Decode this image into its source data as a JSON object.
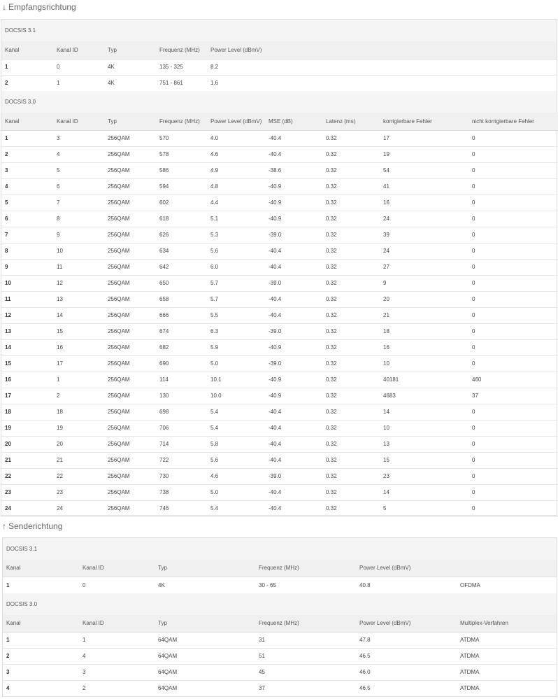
{
  "downstream": {
    "title_arrow": "↓",
    "title": "Empfangsrichtung",
    "docsis31": {
      "label": "DOCSIS 3.1",
      "headers": [
        "Kanal",
        "Kanal ID",
        "Typ",
        "Frequenz (MHz)",
        "Power Level (dBmV)"
      ],
      "rows": [
        [
          "1",
          "0",
          "4K",
          "135 - 325",
          "8.2"
        ],
        [
          "2",
          "1",
          "4K",
          "751 - 861",
          "1.6"
        ]
      ]
    },
    "docsis30": {
      "label": "DOCSIS 3.0",
      "headers": [
        "Kanal",
        "Kanal ID",
        "Typ",
        "Frequenz (MHz)",
        "Power Level (dBmV)",
        "MSE (dB)",
        "Latenz (ms)",
        "korrigierbare Fehler",
        "nicht korrigierbare Fehler"
      ],
      "rows": [
        [
          "1",
          "3",
          "256QAM",
          "570",
          "4.0",
          "-40.4",
          "0.32",
          "17",
          "0"
        ],
        [
          "2",
          "4",
          "256QAM",
          "578",
          "4.6",
          "-40.4",
          "0.32",
          "19",
          "0"
        ],
        [
          "3",
          "5",
          "256QAM",
          "586",
          "4.9",
          "-38.6",
          "0.32",
          "54",
          "0"
        ],
        [
          "4",
          "6",
          "256QAM",
          "594",
          "4.8",
          "-40.9",
          "0.32",
          "41",
          "0"
        ],
        [
          "5",
          "7",
          "256QAM",
          "602",
          "4.4",
          "-40.9",
          "0.32",
          "16",
          "0"
        ],
        [
          "6",
          "8",
          "256QAM",
          "618",
          "5.1",
          "-40.9",
          "0.32",
          "24",
          "0"
        ],
        [
          "7",
          "9",
          "256QAM",
          "626",
          "5.3",
          "-39.0",
          "0.32",
          "39",
          "0"
        ],
        [
          "8",
          "10",
          "256QAM",
          "634",
          "5.6",
          "-40.4",
          "0.32",
          "24",
          "0"
        ],
        [
          "9",
          "11",
          "256QAM",
          "642",
          "6.0",
          "-40.4",
          "0.32",
          "27",
          "0"
        ],
        [
          "10",
          "12",
          "256QAM",
          "650",
          "5.7",
          "-39.0",
          "0.32",
          "9",
          "0"
        ],
        [
          "11",
          "13",
          "256QAM",
          "658",
          "5.7",
          "-40.4",
          "0.32",
          "20",
          "0"
        ],
        [
          "12",
          "14",
          "256QAM",
          "666",
          "5.5",
          "-40.4",
          "0.32",
          "21",
          "0"
        ],
        [
          "13",
          "15",
          "256QAM",
          "674",
          "6.3",
          "-39.0",
          "0.32",
          "18",
          "0"
        ],
        [
          "14",
          "16",
          "256QAM",
          "682",
          "5.9",
          "-40.9",
          "0.32",
          "16",
          "0"
        ],
        [
          "15",
          "17",
          "256QAM",
          "690",
          "5.0",
          "-39.0",
          "0.32",
          "10",
          "0"
        ],
        [
          "16",
          "1",
          "256QAM",
          "114",
          "10.1",
          "-40.9",
          "0.32",
          "40181",
          "460"
        ],
        [
          "17",
          "2",
          "256QAM",
          "130",
          "10.0",
          "-40.9",
          "0.32",
          "4683",
          "37"
        ],
        [
          "18",
          "18",
          "256QAM",
          "698",
          "5.4",
          "-40.4",
          "0.32",
          "14",
          "0"
        ],
        [
          "19",
          "19",
          "256QAM",
          "706",
          "5.4",
          "-40.4",
          "0.32",
          "10",
          "0"
        ],
        [
          "20",
          "20",
          "256QAM",
          "714",
          "5.8",
          "-40.4",
          "0.32",
          "13",
          "0"
        ],
        [
          "21",
          "21",
          "256QAM",
          "722",
          "5.6",
          "-40.4",
          "0.32",
          "15",
          "0"
        ],
        [
          "22",
          "22",
          "256QAM",
          "730",
          "4.6",
          "-39.0",
          "0.32",
          "23",
          "0"
        ],
        [
          "23",
          "23",
          "256QAM",
          "738",
          "5.0",
          "-40.4",
          "0.32",
          "14",
          "0"
        ],
        [
          "24",
          "24",
          "256QAM",
          "746",
          "5.4",
          "-40.4",
          "0.32",
          "5",
          "0"
        ]
      ]
    }
  },
  "upstream": {
    "title_arrow": "↑",
    "title": "Senderichtung",
    "docsis31": {
      "label": "DOCSIS 3.1",
      "headers": [
        "Kanal",
        "Kanal ID",
        "Typ",
        "Frequenz (MHz)",
        "Power Level (dBmV)",
        ""
      ],
      "rows": [
        [
          "1",
          "0",
          "4K",
          "30 - 65",
          "40.8",
          "OFDMA"
        ]
      ]
    },
    "docsis30": {
      "label": "DOCSIS 3.0",
      "headers": [
        "Kanal",
        "Kanal ID",
        "Typ",
        "Frequenz (MHz)",
        "Power Level (dBmV)",
        "Multiplex-Verfahren"
      ],
      "rows": [
        [
          "1",
          "1",
          "64QAM",
          "31",
          "47.8",
          "ATDMA"
        ],
        [
          "2",
          "4",
          "64QAM",
          "51",
          "46.5",
          "ATDMA"
        ],
        [
          "3",
          "3",
          "64QAM",
          "45",
          "46.0",
          "ATDMA"
        ],
        [
          "4",
          "2",
          "64QAM",
          "37",
          "46.5",
          "ATDMA"
        ]
      ]
    }
  }
}
